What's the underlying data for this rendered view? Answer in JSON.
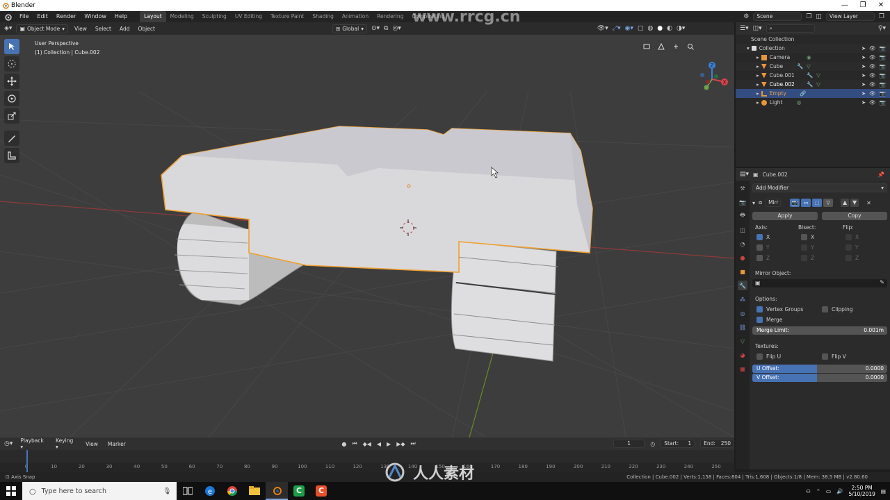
{
  "window": {
    "title": "Blender",
    "controls": [
      "—",
      "❐",
      "✕"
    ]
  },
  "menubar": {
    "menus": [
      "File",
      "Edit",
      "Render",
      "Window",
      "Help"
    ],
    "workspaces": [
      "Layout",
      "Modeling",
      "Sculpting",
      "UV Editing",
      "Texture Paint",
      "Shading",
      "Animation",
      "Rendering",
      "Compositing"
    ],
    "active_workspace": "Layout",
    "scene": "Scene",
    "view_layer": "View Layer"
  },
  "viewport": {
    "mode": "Object Mode",
    "menus": [
      "View",
      "Select",
      "Add",
      "Object"
    ],
    "transform_orientation": "Global",
    "overlay_title": "User Perspective",
    "overlay_subtitle": "(1) Collection | Cube.002"
  },
  "outliner": {
    "root": "Scene Collection",
    "collection": "Collection",
    "items": [
      {
        "name": "Camera",
        "icon": "camera-icon",
        "selected": false
      },
      {
        "name": "Cube",
        "icon": "mesh-icon",
        "selected": false
      },
      {
        "name": "Cube.001",
        "icon": "mesh-icon",
        "selected": false
      },
      {
        "name": "Cube.002",
        "icon": "mesh-icon",
        "selected": false
      },
      {
        "name": "Empty",
        "icon": "empty-icon",
        "selected": true
      },
      {
        "name": "Light",
        "icon": "light-icon",
        "selected": false
      }
    ]
  },
  "properties": {
    "object_name": "Cube.002",
    "add_modifier": "Add Modifier",
    "modifier_name": "Mirr",
    "apply_label": "Apply",
    "copy_label": "Copy",
    "axis_label": "Axis:",
    "bisect_label": "Bisect:",
    "flip_label": "Flip:",
    "axes": [
      "X",
      "Y",
      "Z"
    ],
    "mirror_object_label": "Mirror Object:",
    "options_label": "Options:",
    "vertex_groups": "Vertex Groups",
    "clipping": "Clipping",
    "merge": "Merge",
    "merge_limit_label": "Merge Limit:",
    "merge_limit_value": "0.001m",
    "textures_label": "Textures:",
    "flip_u": "Flip U",
    "flip_v": "Flip V",
    "u_offset_label": "U Offset:",
    "u_offset_value": "0.0000",
    "v_offset_label": "V Offset:",
    "v_offset_value": "0.0000"
  },
  "timeline": {
    "menus": [
      "Playback",
      "Keying",
      "View",
      "Marker"
    ],
    "current_frame": "1",
    "start_label": "Start:",
    "start": "1",
    "end_label": "End:",
    "end": "250",
    "ruler_ticks": [
      "0",
      "10",
      "20",
      "30",
      "40",
      "50",
      "60",
      "70",
      "80",
      "90",
      "100",
      "110",
      "120",
      "130",
      "140",
      "150",
      "160",
      "170",
      "180",
      "190",
      "200",
      "210",
      "220",
      "230",
      "240",
      "250"
    ]
  },
  "statusbar": {
    "left": "Axis Snap",
    "right": "Collection | Cube.002 | Verts:1,158 | Faces:804 | Tris:1,608 | Objects:1/8 | Mem: 38.5 MB | v2.80.60"
  },
  "taskbar": {
    "search_placeholder": "Type here to search",
    "time": "2:50 PM",
    "date": "5/10/2019"
  },
  "watermarks": {
    "top": "www.rrcg.cn",
    "bottom": "人人素材"
  },
  "colors": {
    "selection_outline": "#f0a030",
    "accent": "#4772b3",
    "viewport_bg": "#3d3d3d"
  }
}
